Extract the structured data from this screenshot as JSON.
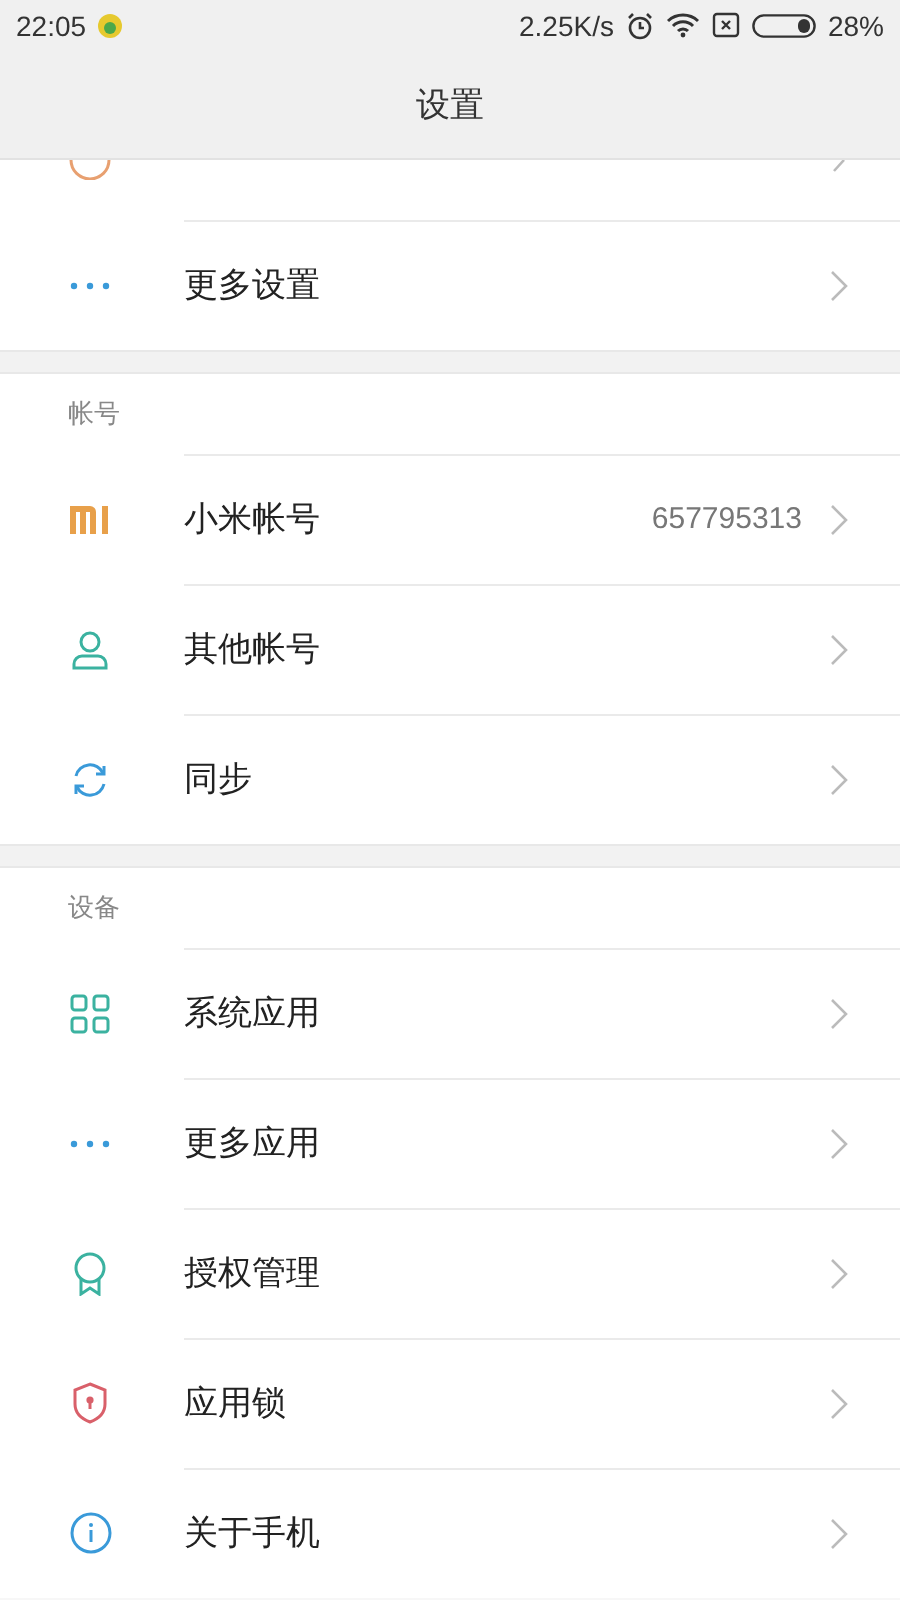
{
  "status_bar": {
    "time": "22:05",
    "speed": "2.25K/s",
    "battery": "28%"
  },
  "title": "设置",
  "sections": [
    {
      "rows": [
        {
          "kind": "dots",
          "label": "更多设置"
        }
      ]
    },
    {
      "header": "帐号",
      "rows": [
        {
          "kind": "mi",
          "label": "小米帐号",
          "value": "657795313"
        },
        {
          "kind": "person",
          "label": "其他帐号"
        },
        {
          "kind": "sync",
          "label": "同步"
        }
      ]
    },
    {
      "header": "设备",
      "rows": [
        {
          "kind": "grid",
          "label": "系统应用"
        },
        {
          "kind": "dots",
          "label": "更多应用"
        },
        {
          "kind": "award",
          "label": "授权管理"
        },
        {
          "kind": "shield",
          "label": "应用锁"
        },
        {
          "kind": "info",
          "label": "关于手机"
        }
      ]
    }
  ]
}
